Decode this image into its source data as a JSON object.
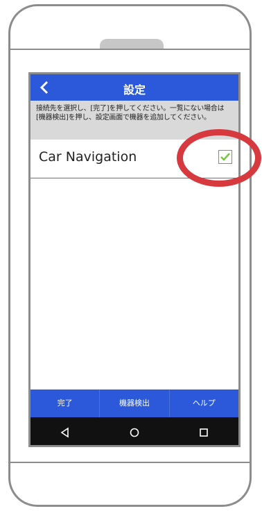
{
  "titlebar": {
    "title": "設定"
  },
  "info": {
    "text": "接続先を選択し、[完了]を押してください。一覧にない場合は[機器検出]を押し、設定画面で機器を追加してください。"
  },
  "devices": [
    {
      "name": "Car Navigation",
      "checked": true
    }
  ],
  "bottombar": {
    "done": "完了",
    "detect": "機器検出",
    "help": "ヘルプ"
  },
  "navbar": {
    "back_icon": "triangle-back-icon",
    "home_icon": "circle-home-icon",
    "recent_icon": "square-recent-icon"
  },
  "colors": {
    "accent": "#2b59d9",
    "highlight": "#d63a3e",
    "check": "#7cc243"
  }
}
